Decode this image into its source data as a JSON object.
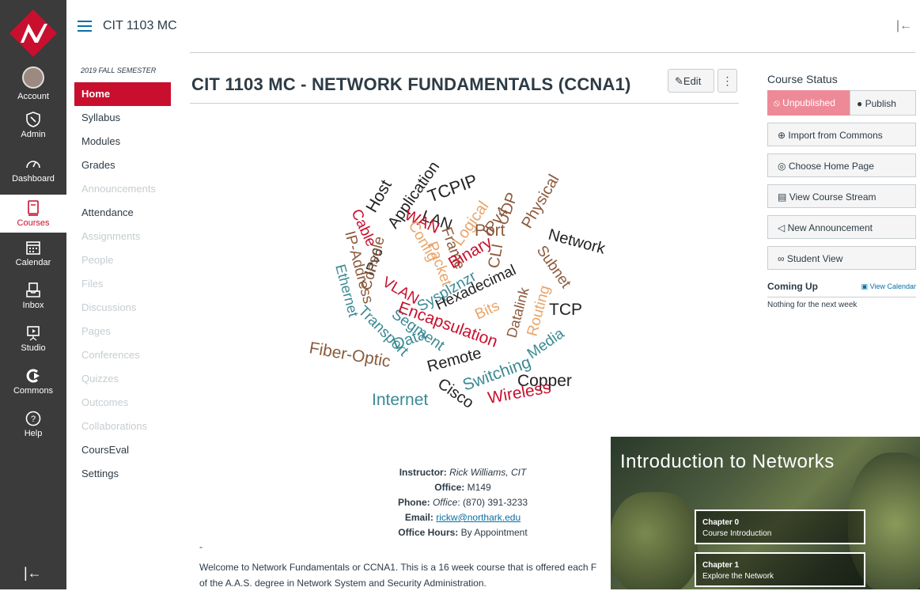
{
  "global_nav": {
    "items": [
      {
        "label": "Account"
      },
      {
        "label": "Admin"
      },
      {
        "label": "Dashboard"
      },
      {
        "label": "Courses"
      },
      {
        "label": "Calendar"
      },
      {
        "label": "Inbox"
      },
      {
        "label": "Studio"
      },
      {
        "label": "Commons"
      },
      {
        "label": "Help"
      }
    ],
    "collapse_glyph": "|←"
  },
  "header": {
    "breadcrumb": "CIT 1103 MC",
    "collapse_glyph": "|←"
  },
  "course_nav": {
    "semester": "2019 FALL SEMESTER",
    "items": [
      {
        "label": "Home",
        "state": "active"
      },
      {
        "label": "Syllabus",
        "state": "enabled"
      },
      {
        "label": "Modules",
        "state": "enabled"
      },
      {
        "label": "Grades",
        "state": "enabled"
      },
      {
        "label": "Announcements",
        "state": "disabled"
      },
      {
        "label": "Attendance",
        "state": "enabled"
      },
      {
        "label": "Assignments",
        "state": "disabled"
      },
      {
        "label": "People",
        "state": "disabled"
      },
      {
        "label": "Files",
        "state": "disabled"
      },
      {
        "label": "Discussions",
        "state": "disabled"
      },
      {
        "label": "Pages",
        "state": "disabled"
      },
      {
        "label": "Conferences",
        "state": "disabled"
      },
      {
        "label": "Quizzes",
        "state": "disabled"
      },
      {
        "label": "Outcomes",
        "state": "disabled"
      },
      {
        "label": "Collaborations",
        "state": "disabled"
      },
      {
        "label": "CoursEval",
        "state": "enabled"
      },
      {
        "label": "Settings",
        "state": "enabled"
      }
    ]
  },
  "main": {
    "title": "CIT 1103 MC - NETWORK FUNDAMENTALS (CCNA1)",
    "edit_label": "Edit",
    "more_glyph": "⋮",
    "word_cloud": [
      "Host",
      "Application",
      "TCPIP",
      "LAN",
      "IPv4",
      "UDP",
      "WAN",
      "Logical",
      "Port",
      "Physical",
      "Network",
      "Cable",
      "IPv6",
      "Config",
      "Packet",
      "Frame",
      "Binary",
      "CLI",
      "Subnet",
      "IP-Address",
      "Console",
      "VLAN",
      "Sysplznzr",
      "Hexadecimal",
      "Datalink",
      "TCP",
      "Ethernet",
      "Bits",
      "Routing",
      "Transport",
      "Segment",
      "Encapsulation",
      "Media",
      "Fiber-Optic",
      "Data",
      "Remote",
      "Switching",
      "Copper",
      "Internet",
      "Cisco",
      "Wireless"
    ],
    "contact": {
      "instructor_label": "Instructor:",
      "instructor_value": "Rick Williams, CIT",
      "office_label": "Office:",
      "office_value": "M149",
      "phone_label": "Phone:",
      "phone_type": "Office",
      "phone_value": "(870) 391-3233",
      "email_label": "Email:",
      "email_value": "rickw@northark.edu",
      "hours_label": "Office Hours:",
      "hours_value": "By Appointment"
    },
    "dash": "-",
    "welcome_line1": "Welcome to Network Fundamentals or CCNA1.  This is a 16 week course that is offered each F",
    "welcome_line2": "of the A.A.S. degree in Network System and Security Administration."
  },
  "aside": {
    "status_heading": "Course Status",
    "unpublished_label": "Unpublished",
    "publish_label": "Publish",
    "buttons": [
      {
        "label": "Import from Commons"
      },
      {
        "label": "Choose Home Page"
      },
      {
        "label": "View Course Stream"
      },
      {
        "label": "New Announcement"
      },
      {
        "label": "Student View"
      }
    ],
    "coming_up": "Coming Up",
    "view_calendar": "View Calendar",
    "nothing": "Nothing for the next week"
  },
  "video": {
    "title": "Introduction to Networks",
    "chapters": [
      {
        "number": "Chapter 0",
        "name": "Course Introduction"
      },
      {
        "number": "Chapter 1",
        "name": "Explore the Network"
      }
    ]
  },
  "colors": {
    "brand_red": "#c8102e",
    "nav_bg": "#3b3b3b",
    "link_blue": "#0770a3",
    "unpublished_pink": "#ee8a98"
  }
}
